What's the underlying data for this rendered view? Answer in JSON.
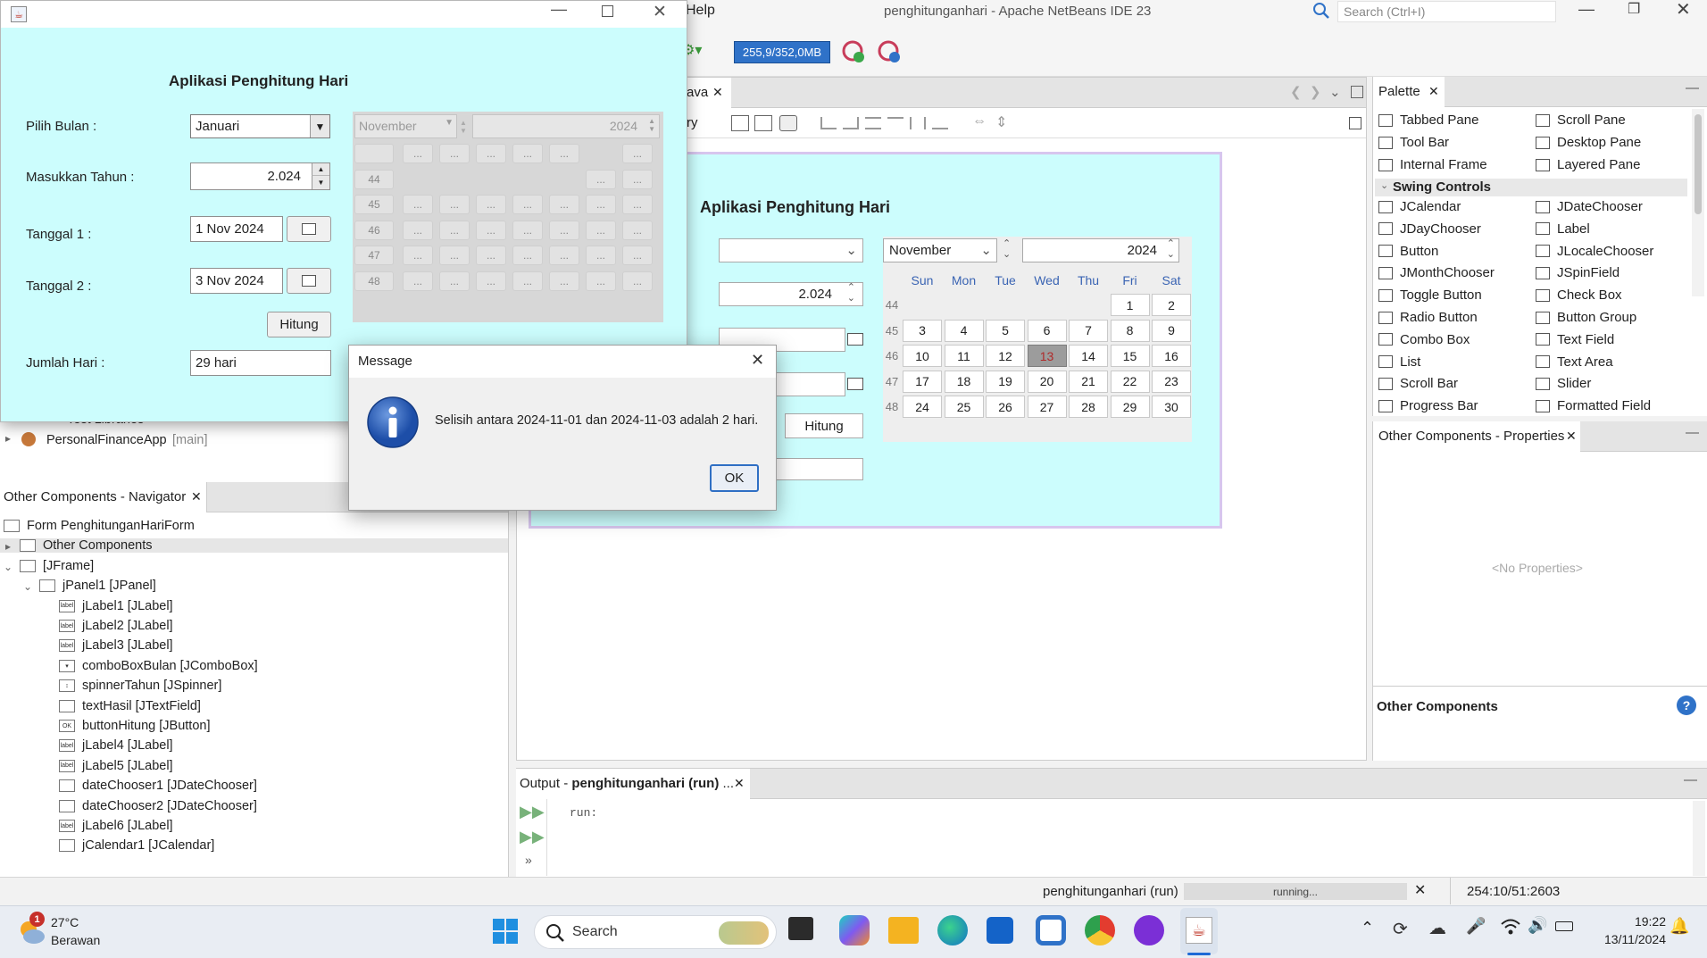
{
  "ide": {
    "menu_help": "Help",
    "title": "penghitunganhari - Apache NetBeans IDE 23",
    "search_placeholder": "Search (Ctrl+I)",
    "memory": "255,9/352,0MB",
    "editor_tab": "ava",
    "editor_toolbar_left": "ry",
    "palette_tab": "Palette",
    "palette_section": "Swing Controls",
    "palette_items_top_left": [
      "Tabbed Pane",
      "Tool Bar",
      "Internal Frame"
    ],
    "palette_items_top_right": [
      "Scroll Pane",
      "Desktop Pane",
      "Layered Pane"
    ],
    "palette_left": [
      "JCalendar",
      "JDayChooser",
      "Button",
      "JMonthChooser",
      "Toggle Button",
      "Radio Button",
      "Combo Box",
      "List",
      "Scroll Bar",
      "Progress Bar"
    ],
    "palette_right": [
      "JDateChooser",
      "Label",
      "JLocaleChooser",
      "JSpinField",
      "Check Box",
      "Button Group",
      "Text Field",
      "Text Area",
      "Slider",
      "Formatted Field"
    ],
    "properties_tab": "Other Components - Properties",
    "no_properties": "<No Properties>",
    "properties_footer": "Other Components",
    "output_tab_prefix": "Output - ",
    "output_tab_name": "penghitunganhari (run)",
    "output_tab_suffix": " ...",
    "output_text": "run:",
    "status_project": "penghitunganhari (run)",
    "status_progress": "running...",
    "status_position": "254:10/51:2603",
    "project_libraries": "Test Libraries",
    "project_name": "PersonalFinanceApp",
    "project_branch": "[main]"
  },
  "navigator": {
    "tab": "Other Components - Navigator",
    "items": [
      {
        "label": "Form PenghitunganHariForm",
        "icon": "form-icon"
      },
      {
        "label": "Other Components",
        "icon": "components-icon"
      },
      {
        "label": "[JFrame]",
        "icon": "frame-icon"
      },
      {
        "label": "jPanel1 [JPanel]",
        "icon": "panel-icon"
      },
      {
        "label": "jLabel1 [JLabel]",
        "icon": "label-icon"
      },
      {
        "label": "jLabel2 [JLabel]",
        "icon": "label-icon"
      },
      {
        "label": "jLabel3 [JLabel]",
        "icon": "label-icon"
      },
      {
        "label": "comboBoxBulan [JComboBox]",
        "icon": "combobox-icon"
      },
      {
        "label": "spinnerTahun [JSpinner]",
        "icon": "spinner-icon"
      },
      {
        "label": "textHasil [JTextField]",
        "icon": "textfield-icon"
      },
      {
        "label": "buttonHitung [JButton]",
        "icon": "button-icon"
      },
      {
        "label": "jLabel4 [JLabel]",
        "icon": "label-icon"
      },
      {
        "label": "jLabel5 [JLabel]",
        "icon": "label-icon"
      },
      {
        "label": "dateChooser1 [JDateChooser]",
        "icon": "datechooser-icon"
      },
      {
        "label": "dateChooser2 [JDateChooser]",
        "icon": "datechooser-icon"
      },
      {
        "label": "jLabel6 [JLabel]",
        "icon": "label-icon"
      },
      {
        "label": "jCalendar1 [JCalendar]",
        "icon": "calendar-icon"
      }
    ]
  },
  "design": {
    "title": "Aplikasi Penghitung Hari",
    "year_value": "2.024",
    "button_label": "Hitung",
    "calendar_month": "November",
    "calendar_year": "2024",
    "weekdays": [
      "Sun",
      "Mon",
      "Tue",
      "Wed",
      "Thu",
      "Fri",
      "Sat"
    ],
    "week_numbers": [
      "44",
      "45",
      "46",
      "47",
      "48"
    ],
    "weeks": [
      [
        "",
        "",
        "",
        "",
        "",
        "1",
        "2"
      ],
      [
        "3",
        "4",
        "5",
        "6",
        "7",
        "8",
        "9"
      ],
      [
        "10",
        "11",
        "12",
        "13",
        "14",
        "15",
        "16"
      ],
      [
        "17",
        "18",
        "19",
        "20",
        "21",
        "22",
        "23"
      ],
      [
        "24",
        "25",
        "26",
        "27",
        "28",
        "29",
        "30"
      ]
    ],
    "selected_day": "13"
  },
  "app": {
    "title": "Aplikasi Penghitung Hari",
    "label_month": "Pilih Bulan :",
    "month_value": "Januari",
    "label_year": "Masukkan Tahun :",
    "year_value": "2.024",
    "label_date1": "Tanggal 1 :",
    "date1_value": "1 Nov 2024",
    "label_date2": "Tanggal 2 :",
    "date2_value": "3 Nov 2024",
    "button_label": "Hitung",
    "label_result": "Jumlah Hari :",
    "result_value": "29 hari",
    "calendar_month": "November",
    "calendar_year": "2024",
    "week_numbers": [
      "44",
      "45",
      "46",
      "47",
      "48"
    ],
    "placeholder_cell": "..."
  },
  "dialog": {
    "title": "Message",
    "message": "Selisih antara 2024-11-01 dan 2024-11-03 adalah 2 hari.",
    "ok_label": "OK"
  },
  "taskbar": {
    "weather_temp": "27°C",
    "weather_desc": "Berawan",
    "weather_badge": "1",
    "search_label": "Search",
    "time": "19:22",
    "date": "13/11/2024"
  },
  "colors": {
    "form_background": "#ccfdfd",
    "accent_blue": "#2f72c8",
    "selected_day_bg": "#9c9c9c",
    "selected_day_text": "#b02a2a"
  }
}
